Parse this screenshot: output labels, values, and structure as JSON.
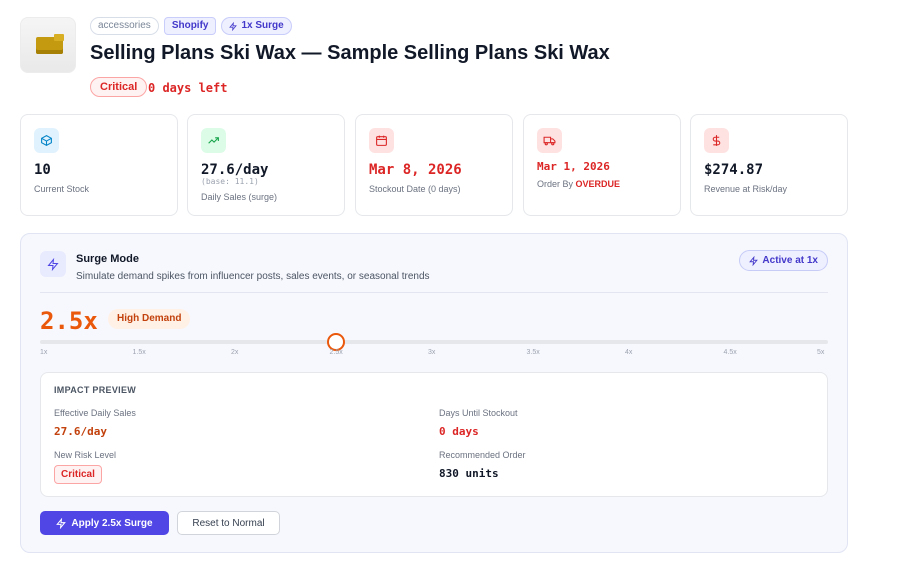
{
  "header": {
    "tags": {
      "category": "accessories",
      "platform": "Shopify",
      "surge": "1x Surge"
    },
    "title": "Selling Plans Ski Wax — Sample Selling Plans Ski Wax",
    "risk_badge": "Critical",
    "days_left": "0 days left"
  },
  "stats": {
    "stock": {
      "value": "10",
      "label": "Current Stock",
      "icon": "box-icon"
    },
    "sales": {
      "value": "27.6/day",
      "sub": "(base: 11.1)",
      "label": "Daily Sales (surge)",
      "icon": "trending-up-icon"
    },
    "stockout": {
      "value": "Mar 8, 2026",
      "label": "Stockout Date (0 days)",
      "icon": "calendar-icon"
    },
    "order_by": {
      "value": "Mar 1, 2026",
      "label_prefix": "Order By",
      "label_status": "OVERDUE",
      "icon": "truck-icon"
    },
    "revenue": {
      "value": "$274.87",
      "label": "Revenue at Risk/day",
      "icon": "dollar-icon"
    }
  },
  "surge": {
    "title": "Surge Mode",
    "description": "Simulate demand spikes from influencer posts, sales events, or seasonal trends",
    "active_label": "Active at 1x",
    "multiplier": "2.5x",
    "demand_label": "High Demand",
    "slider": {
      "min": 1,
      "max": 5,
      "value": 2.5,
      "ticks": [
        "1x",
        "1.5x",
        "2x",
        "2.5x",
        "3x",
        "3.5x",
        "4x",
        "4.5x",
        "5x"
      ]
    },
    "impact": {
      "heading": "IMPACT PREVIEW",
      "effective_sales_label": "Effective Daily Sales",
      "effective_sales_value": "27.6/day",
      "days_until_label": "Days Until Stockout",
      "days_until_value": "0 days",
      "risk_label": "New Risk Level",
      "risk_value": "Critical",
      "order_label": "Recommended Order",
      "order_value": "830 units"
    },
    "apply_label": "Apply 2.5x Surge",
    "reset_label": "Reset to Normal"
  },
  "colors": {
    "accent": "#4f46e5",
    "critical": "#dc2626",
    "surge": "#ea580c"
  }
}
